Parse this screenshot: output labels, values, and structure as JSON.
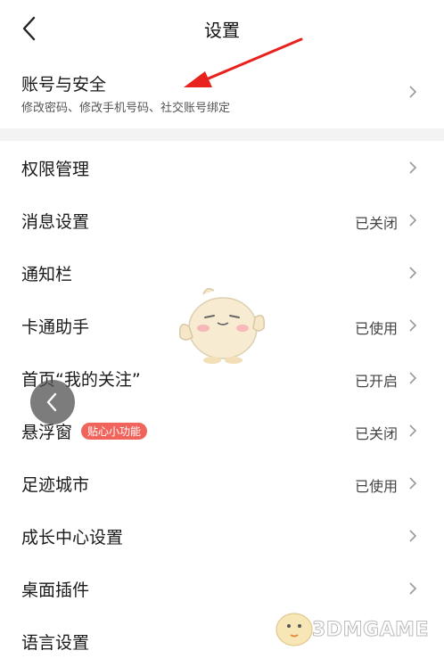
{
  "header": {
    "title": "设置"
  },
  "account": {
    "label": "账号与安全",
    "sub": "修改密码、修改手机号码、社交账号绑定"
  },
  "rows": [
    {
      "label": "权限管理",
      "status": ""
    },
    {
      "label": "消息设置",
      "status": "已关闭"
    },
    {
      "label": "通知栏",
      "status": ""
    },
    {
      "label": "卡通助手",
      "status": "已使用"
    },
    {
      "label": "首页“我的关注”",
      "status": "已开启"
    },
    {
      "label": "悬浮窗",
      "status": "已关闭",
      "badge": "贴心小功能"
    },
    {
      "label": "足迹城市",
      "status": "已使用"
    },
    {
      "label": "成长中心设置",
      "status": ""
    },
    {
      "label": "桌面插件",
      "status": ""
    },
    {
      "label": "语言设置",
      "status": ""
    }
  ],
  "watermark": {
    "text": "3DMGAME"
  },
  "colors": {
    "badge": "#f0645c",
    "arrow": "#e8211c",
    "divider": "#f3f3f3"
  }
}
